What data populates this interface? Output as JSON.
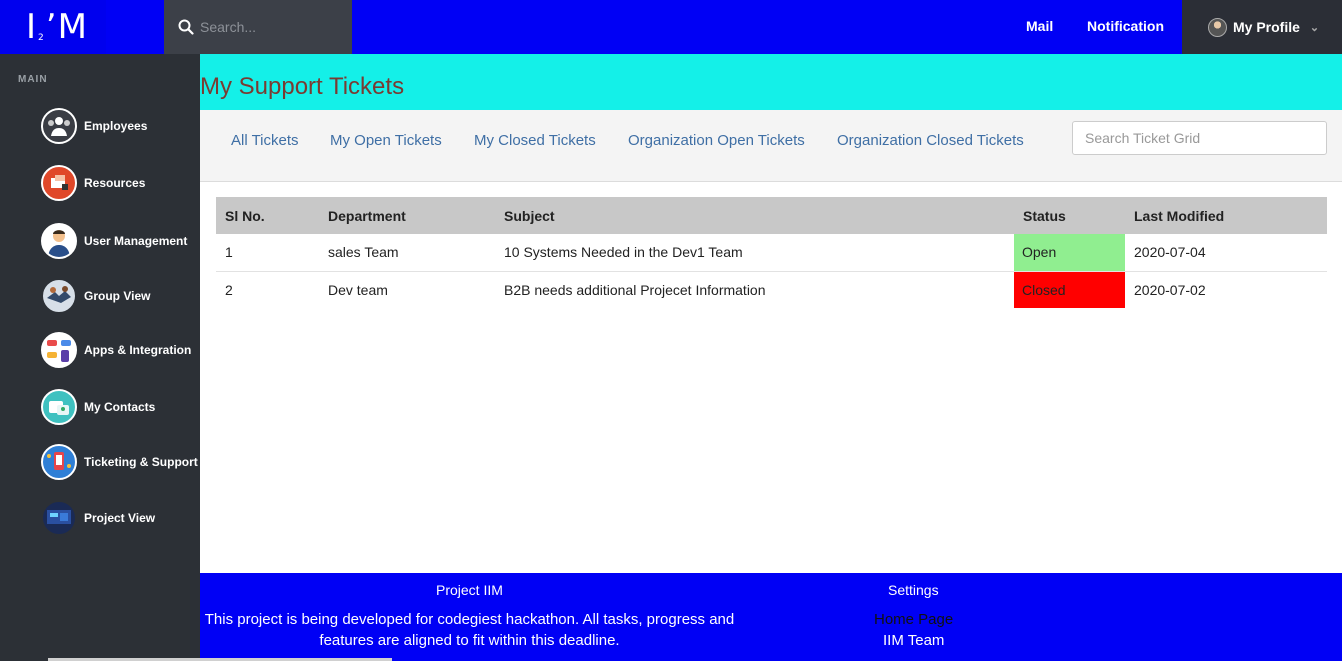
{
  "topbar": {
    "logo_text": "I’M",
    "logo_sub": "2",
    "search_placeholder": "Search...",
    "mail_label": "Mail",
    "notification_label": "Notification",
    "profile_label": "My Profile"
  },
  "sidebar": {
    "section_label": "MAIN",
    "items": [
      {
        "label": "Employees",
        "icon": "employees-icon"
      },
      {
        "label": "Resources",
        "icon": "resources-icon"
      },
      {
        "label": "User Management",
        "icon": "user-management-icon"
      },
      {
        "label": "Group View",
        "icon": "group-view-icon"
      },
      {
        "label": "Apps & Integration",
        "icon": "apps-integration-icon"
      },
      {
        "label": "My Contacts",
        "icon": "contacts-icon"
      },
      {
        "label": "Ticketing & Support",
        "icon": "ticketing-icon"
      },
      {
        "label": "Project View",
        "icon": "project-view-icon"
      }
    ]
  },
  "page": {
    "title": "My Support Tickets"
  },
  "tabs": {
    "all": "All Tickets",
    "my_open": "My Open Tickets",
    "my_closed": "My Closed Tickets",
    "org_open": "Organization Open Tickets",
    "org_closed": "Organization Closed Tickets",
    "search_placeholder": "Search Ticket Grid"
  },
  "table": {
    "headers": {
      "sl": "Sl No.",
      "department": "Department",
      "subject": "Subject",
      "status": "Status",
      "last_modified": "Last Modified"
    },
    "rows": [
      {
        "sl": "1",
        "department": "sales Team",
        "subject": "10 Systems Needed in the Dev1 Team",
        "status": "Open",
        "last_modified": "2020-07-04"
      },
      {
        "sl": "2",
        "department": "Dev team",
        "subject": "B2B needs additional Projecet Information",
        "status": "Closed",
        "last_modified": "2020-07-02"
      }
    ]
  },
  "footer": {
    "col1_title": "Project IIM",
    "col1_text": "This project is being developed for codegiest hackathon. All tasks, progress and features are aligned to fit within this deadline.",
    "col2_title": "Settings",
    "link_home": "Home Page",
    "link_team": "IIM Team"
  },
  "colors": {
    "topbar": "#0000f5",
    "sidebar": "#2c3036",
    "page_header": "#14f0e8",
    "status_open": "#90ee90",
    "status_closed": "#ff0000",
    "footer": "#0000f5"
  }
}
